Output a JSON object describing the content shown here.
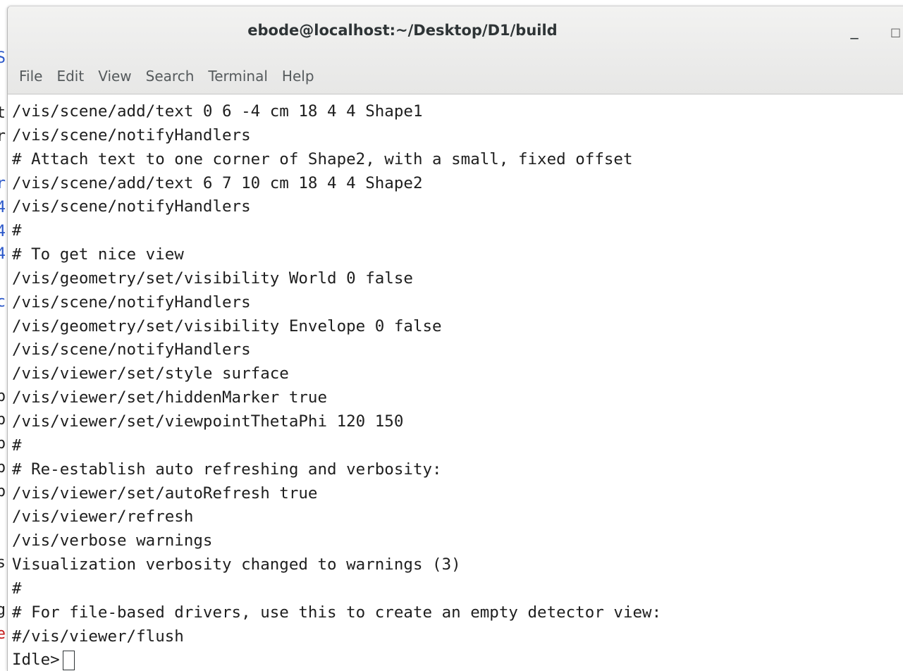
{
  "window": {
    "title": "ebode@localhost:~/Desktop/D1/build",
    "minimize_label": "_",
    "maximize_label": "□"
  },
  "menu": {
    "items": [
      "File",
      "Edit",
      "View",
      "Search",
      "Terminal",
      "Help"
    ]
  },
  "terminal": {
    "lines": [
      "/vis/scene/add/text 0 6 -4 cm 18 4 4 Shape1",
      "/vis/scene/notifyHandlers",
      "# Attach text to one corner of Shape2, with a small, fixed offset",
      "/vis/scene/add/text 6 7 10 cm 18 4 4 Shape2",
      "/vis/scene/notifyHandlers",
      "#",
      "# To get nice view",
      "/vis/geometry/set/visibility World 0 false",
      "/vis/scene/notifyHandlers",
      "/vis/geometry/set/visibility Envelope 0 false",
      "/vis/scene/notifyHandlers",
      "/vis/viewer/set/style surface",
      "/vis/viewer/set/hiddenMarker true",
      "/vis/viewer/set/viewpointThetaPhi 120 150",
      "#",
      "# Re-establish auto refreshing and verbosity:",
      "/vis/viewer/set/autoRefresh true",
      "/vis/viewer/refresh",
      "/vis/verbose warnings",
      "Visualization verbosity changed to warnings (3)",
      "#",
      "# For file-based drivers, use this to create an empty detector view:",
      "#/vis/viewer/flush"
    ],
    "prompt": "Idle>"
  },
  "background_window": {
    "fragments": [
      {
        "text": "S",
        "color": "#2a57c9"
      },
      {
        "text": "t",
        "color": "#1e1e1e"
      },
      {
        "text": "r",
        "color": "#1e1e1e"
      },
      {
        "text": "r",
        "color": "#2a57c9"
      },
      {
        "text": "4",
        "color": "#2a57c9"
      },
      {
        "text": "4",
        "color": "#2a57c9"
      },
      {
        "text": "4",
        "color": "#2a57c9"
      },
      {
        "text": "c",
        "color": "#2a57c9"
      },
      {
        "text": "b",
        "color": "#1e1e1e"
      },
      {
        "text": "b",
        "color": "#1e1e1e"
      },
      {
        "text": "b",
        "color": "#1e1e1e"
      },
      {
        "text": "b",
        "color": "#1e1e1e"
      },
      {
        "text": "b",
        "color": "#1e1e1e"
      },
      {
        "text": "s",
        "color": "#1e1e1e"
      },
      {
        "text": "g",
        "color": "#1e1e1e"
      },
      {
        "text": "e",
        "color": "#c41a1a"
      }
    ]
  }
}
